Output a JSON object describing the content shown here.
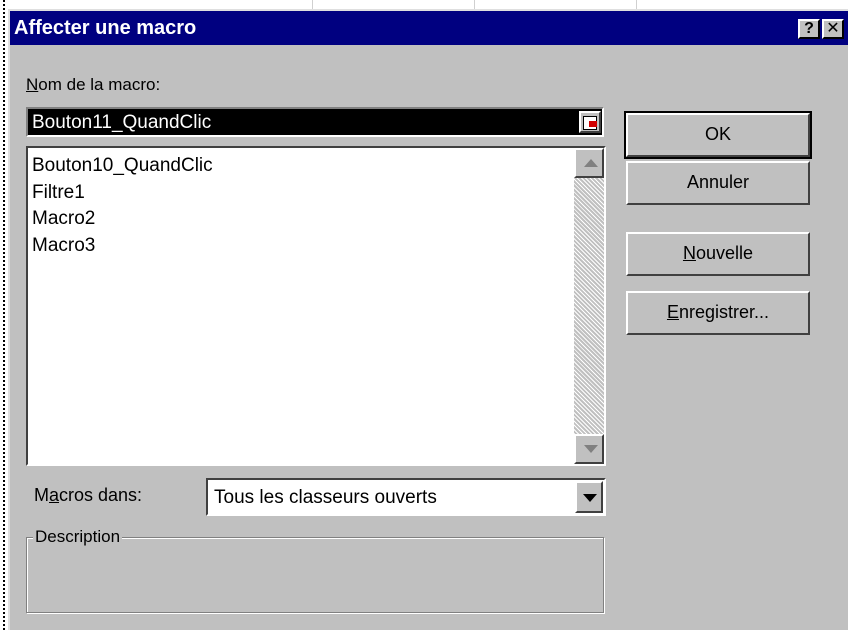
{
  "dialog": {
    "title": "Affecter une macro",
    "help_button": "?",
    "close_button": "✕"
  },
  "macro_name": {
    "label_accel": "N",
    "label_rest": "om de la macro:",
    "value": "Bouton11_QuandClic"
  },
  "macro_list": {
    "items": [
      "Bouton10_QuandClic",
      "Filtre1",
      "Macro2",
      "Macro3"
    ]
  },
  "buttons": {
    "ok": "OK",
    "cancel": "Annuler",
    "new_accel": "N",
    "new_rest": "ouvelle",
    "record_accel": "E",
    "record_rest": "nregistrer..."
  },
  "macros_in": {
    "label_pre": "M",
    "label_accel": "a",
    "label_rest": "cros dans:",
    "selected": "Tous les classeurs ouverts"
  },
  "description": {
    "label": "Description",
    "text": ""
  }
}
